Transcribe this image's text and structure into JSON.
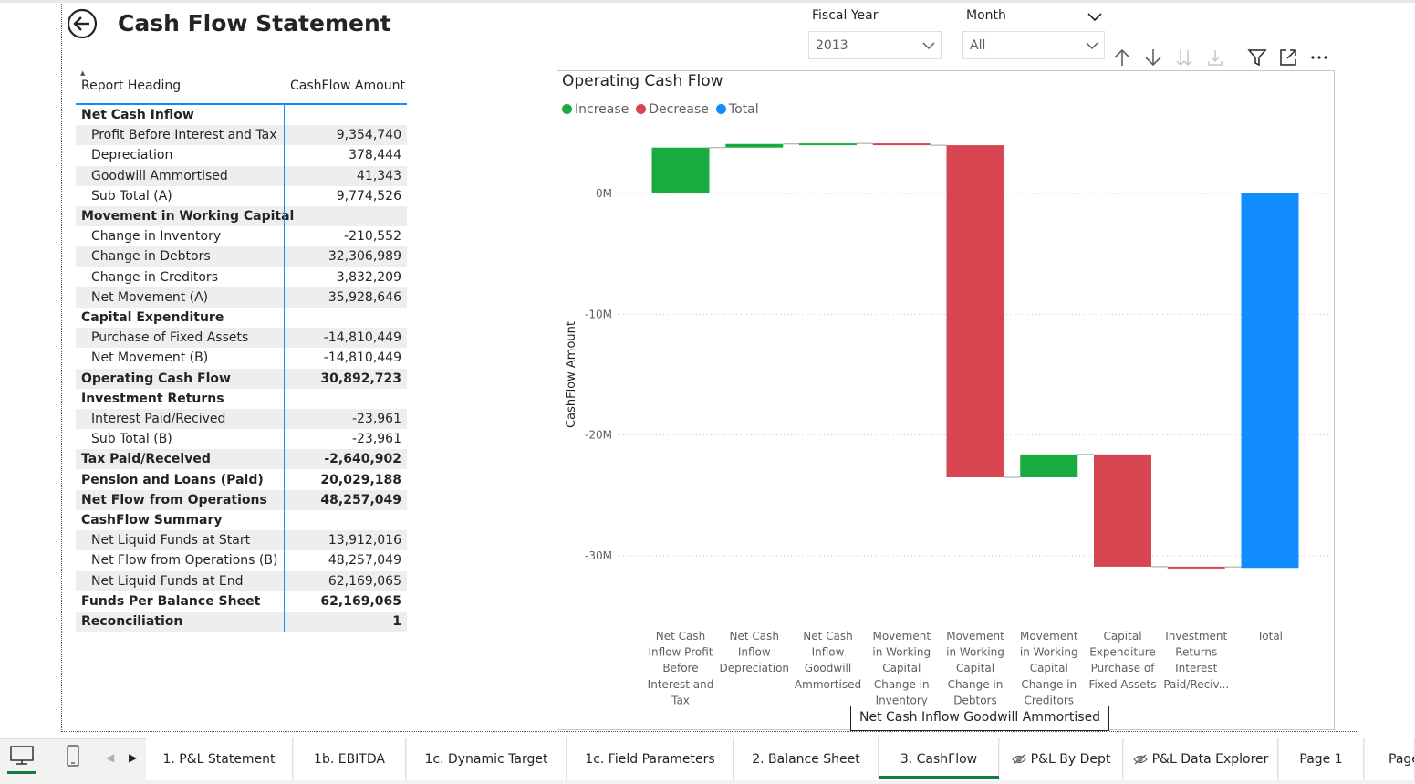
{
  "page": {
    "title": "Cash Flow Statement"
  },
  "slicers": {
    "fiscal_year": {
      "label": "Fiscal Year",
      "value": "2013"
    },
    "month": {
      "label": "Month",
      "value": "All"
    }
  },
  "table": {
    "headers": [
      "Report Heading",
      "CashFlow Amount"
    ],
    "rows": [
      {
        "label": "Net Cash Inflow",
        "value": "",
        "bold": true,
        "indent": false
      },
      {
        "label": "Profit Before Interest and Tax",
        "value": "9,354,740",
        "bold": false,
        "indent": true
      },
      {
        "label": "Depreciation",
        "value": "378,444",
        "bold": false,
        "indent": true
      },
      {
        "label": "Goodwill Ammortised",
        "value": "41,343",
        "bold": false,
        "indent": true
      },
      {
        "label": "Sub Total (A)",
        "value": "9,774,526",
        "bold": false,
        "indent": true
      },
      {
        "label": "Movement in Working Capital",
        "value": "",
        "bold": true,
        "indent": false
      },
      {
        "label": "Change in Inventory",
        "value": "-210,552",
        "bold": false,
        "indent": true
      },
      {
        "label": "Change in Debtors",
        "value": "32,306,989",
        "bold": false,
        "indent": true
      },
      {
        "label": "Change in Creditors",
        "value": "3,832,209",
        "bold": false,
        "indent": true
      },
      {
        "label": "Net Movement (A)",
        "value": "35,928,646",
        "bold": false,
        "indent": true
      },
      {
        "label": "Capital Expenditure",
        "value": "",
        "bold": true,
        "indent": false
      },
      {
        "label": "Purchase of Fixed Assets",
        "value": "-14,810,449",
        "bold": false,
        "indent": true
      },
      {
        "label": "Net Movement (B)",
        "value": "-14,810,449",
        "bold": false,
        "indent": true
      },
      {
        "label": "Operating Cash Flow",
        "value": "30,892,723",
        "bold": true,
        "indent": false
      },
      {
        "label": "Investment Returns",
        "value": "",
        "bold": true,
        "indent": false
      },
      {
        "label": "Interest Paid/Recived",
        "value": "-23,961",
        "bold": false,
        "indent": true
      },
      {
        "label": "Sub Total (B)",
        "value": "-23,961",
        "bold": false,
        "indent": true
      },
      {
        "label": "Tax Paid/Received",
        "value": "-2,640,902",
        "bold": true,
        "indent": false
      },
      {
        "label": "Pension and Loans (Paid)",
        "value": "20,029,188",
        "bold": true,
        "indent": false
      },
      {
        "label": "Net Flow from Operations",
        "value": "48,257,049",
        "bold": true,
        "indent": false
      },
      {
        "label": "CashFlow Summary",
        "value": "",
        "bold": true,
        "indent": false
      },
      {
        "label": "Net Liquid Funds at Start",
        "value": "13,912,016",
        "bold": false,
        "indent": true
      },
      {
        "label": "Net Flow from Operations (B)",
        "value": "48,257,049",
        "bold": false,
        "indent": true
      },
      {
        "label": "Net Liquid Funds at End",
        "value": "62,169,065",
        "bold": false,
        "indent": true
      },
      {
        "label": "Funds Per Balance Sheet",
        "value": "62,169,065",
        "bold": true,
        "indent": false
      },
      {
        "label": "Reconciliation",
        "value": "1",
        "bold": true,
        "indent": false
      }
    ]
  },
  "chart_data": {
    "type": "waterfall",
    "title": "Operating Cash Flow",
    "ylabel": "CashFlow Amount",
    "xlabel": "",
    "ylim": [
      -35000000,
      8000000
    ],
    "yticks": [
      0,
      -10000000,
      -20000000,
      -30000000
    ],
    "ytick_labels": [
      "0M",
      "-10M",
      "-20M",
      "-30M"
    ],
    "grid": true,
    "legend": {
      "position": "top-left",
      "entries": [
        {
          "name": "Increase",
          "color": "#1aab40"
        },
        {
          "name": "Decrease",
          "color": "#d64550"
        },
        {
          "name": "Total",
          "color": "#118dff"
        }
      ]
    },
    "categories": [
      "Net Cash Inflow Profit Before Interest and Tax",
      "Net Cash Inflow Depreciation",
      "Net Cash Inflow Goodwill Ammortised",
      "Movement in Working Capital Change in Inventory",
      "Movement in Working Capital Change in Debtors",
      "Movement in Working Capital Change in Creditors",
      "Capital Expenditure Purchase of Fixed Assets",
      "Investment Returns Interest Paid/Reciv...",
      "Total"
    ],
    "category_lines": [
      [
        "Net Cash",
        "Inflow Profit",
        "Before",
        "Interest and",
        "Tax"
      ],
      [
        "Net Cash",
        "Inflow",
        "Depreciation"
      ],
      [
        "Net Cash",
        "Inflow",
        "Goodwill",
        "Ammortised"
      ],
      [
        "Movement",
        "in Working",
        "Capital",
        "Change in",
        "Inventory"
      ],
      [
        "Movement",
        "in Working",
        "Capital",
        "Change in",
        "Debtors"
      ],
      [
        "Movement",
        "in Working",
        "Capital",
        "Change in",
        "Creditors"
      ],
      [
        "Capital",
        "Expenditure",
        "Purchase of",
        "Fixed Assets"
      ],
      [
        "Investment",
        "Returns",
        "Interest",
        "Paid/Reciv..."
      ],
      [
        "Total"
      ]
    ],
    "values": [
      3800000,
      300000,
      50000,
      -150000,
      -27500000,
      1900000,
      -9300000,
      -20000,
      -31000000
    ],
    "kinds": [
      "increase",
      "increase",
      "increase",
      "decrease",
      "decrease",
      "increase",
      "decrease",
      "decrease",
      "total"
    ]
  },
  "tooltip": {
    "text": "Net Cash Inflow Goodwill Ammortised"
  },
  "tabs": [
    {
      "label": "1. P&L Statement",
      "hidden": false
    },
    {
      "label": "1b. EBITDA",
      "hidden": false
    },
    {
      "label": "1c. Dynamic Target",
      "hidden": false
    },
    {
      "label": "1c. Field Parameters",
      "hidden": false
    },
    {
      "label": "2. Balance Sheet",
      "hidden": false
    },
    {
      "label": "3. CashFlow",
      "hidden": false,
      "active": true
    },
    {
      "label": "P&L By Dept",
      "hidden": true
    },
    {
      "label": "P&L Data Explorer",
      "hidden": true
    },
    {
      "label": "Page 1",
      "hidden": false
    },
    {
      "label": "Page",
      "hidden": false
    }
  ],
  "icons": {
    "back": "back-arrow-circle-icon",
    "sort_up": "arrow-up-icon",
    "sort_down": "arrow-down-icon",
    "drill_all": "double-arrow-down-icon",
    "expand": "expand-hierarchy-icon",
    "filter": "filter-icon",
    "focus": "focus-mode-icon",
    "more": "more-options-icon"
  }
}
